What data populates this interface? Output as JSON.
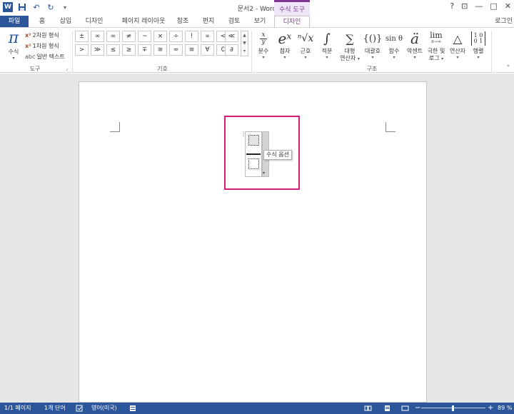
{
  "window": {
    "title": "문서2 - Word",
    "context_tab_title": "수식 도구",
    "help": "?",
    "restore": "⊡",
    "minimize": "—",
    "maximize": "□",
    "close": "✕"
  },
  "qat": {
    "app_icon": "W",
    "save_icon": "💾",
    "undo_icon": "↶",
    "redo_icon": "↻",
    "customize_icon": "▾"
  },
  "tabs": [
    {
      "label": "파일"
    },
    {
      "label": "홈"
    },
    {
      "label": "삽입"
    },
    {
      "label": "디자인"
    },
    {
      "label": "페이지 레이아웃"
    },
    {
      "label": "참조"
    },
    {
      "label": "편지"
    },
    {
      "label": "검토"
    },
    {
      "label": "보기"
    },
    {
      "label": "디자인"
    }
  ],
  "signin": "로그인",
  "ribbon": {
    "tools": {
      "equation_glyph": "π",
      "equation_label": "수식",
      "professional": "2차원 형식",
      "linear": "1차원 형식",
      "normal_text": "일반 텍스트",
      "group_label": "도구",
      "expander": "⌟"
    },
    "symbols": {
      "row1": [
        "±",
        "∞",
        "=",
        "≠",
        "~",
        "×",
        "÷",
        "!",
        "∝",
        "<",
        "≪"
      ],
      "row2": [
        ">",
        "≫",
        "≤",
        "≥",
        "∓",
        "≅",
        "≈",
        "≡",
        "∀",
        "∁",
        "∂"
      ],
      "scroll_up": "▲",
      "scroll_down": "▼",
      "more": "▾",
      "group_label": "기호"
    },
    "structures": {
      "items": [
        {
          "glyph": "x/y",
          "label": "분수"
        },
        {
          "glyph": "eˣ",
          "label": "첨자"
        },
        {
          "glyph": "ⁿ√x",
          "label": "근호"
        },
        {
          "glyph": "∫",
          "label": "적분"
        },
        {
          "glyph": "∑",
          "label": "대형",
          "label2": "연산자"
        },
        {
          "glyph": "{()}",
          "label": "대괄호"
        },
        {
          "glyph": "sin θ",
          "label": "함수"
        },
        {
          "glyph": "ä",
          "label": "악센트"
        },
        {
          "glyph": "lim",
          "label": "극한 및",
          "label2": "로그"
        },
        {
          "glyph": "△",
          "label": "연산자"
        },
        {
          "glyph": "[10 01]",
          "label": "행렬"
        }
      ],
      "group_label": "구조",
      "dropdown": "▾",
      "collapse": "˄"
    }
  },
  "document": {
    "handle_glyph": "⋮",
    "dropdown_arrow": "▾",
    "tooltip": "수식 옵션"
  },
  "statusbar": {
    "page": "1/1 페이지",
    "words": "1개 단어",
    "language": "영어(미국)",
    "zoom": "89 %",
    "zoom_minus": "−",
    "zoom_plus": "+",
    "zoom_level": 0.48
  }
}
